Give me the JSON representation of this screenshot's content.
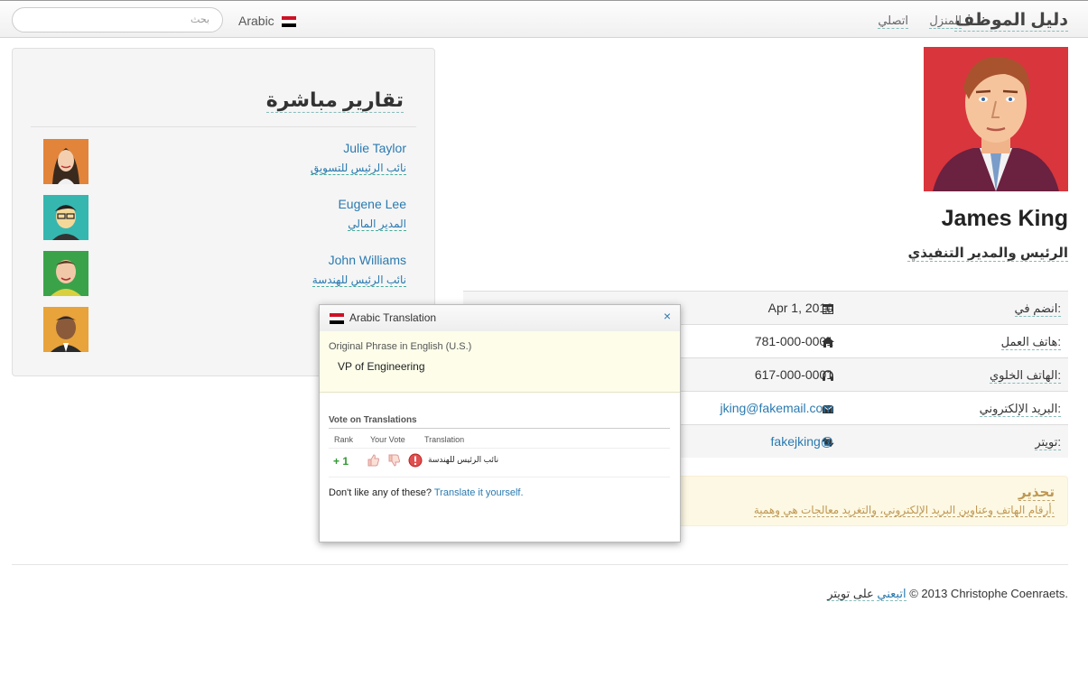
{
  "navbar": {
    "brand": "دليل الموظف",
    "home": "المنزل",
    "contact": "اتصلي",
    "language": "Arabic",
    "search_placeholder": "بحث"
  },
  "reports": {
    "title": "تقارير مباشرة",
    "items": [
      {
        "name": "Julie Taylor",
        "title": "نائب الرئيس للتسويق"
      },
      {
        "name": "Eugene Lee",
        "title": "المدير المالي"
      },
      {
        "name": "John Williams",
        "title": "نائب الرئيس للهندسة"
      },
      {
        "name": "",
        "title": ""
      }
    ]
  },
  "profile": {
    "name": "James King",
    "title": "الرئيس والمدير التنفيذي",
    "details": [
      {
        "label": "انضم في:",
        "value": "Apr 1, 2010",
        "icon": "calendar-icon"
      },
      {
        "label": "هاتف العمل:",
        "value": "781-000-0001",
        "icon": "home-icon"
      },
      {
        "label": "الهاتف الخلوي:",
        "value": "617-000-0001",
        "icon": "headphones-icon"
      },
      {
        "label": "البريد الإلكتروني:",
        "value": "jking@fakemail.com",
        "icon": "envelope-icon"
      },
      {
        "label": "تويتر:",
        "value": "fakejking@",
        "icon": "retweet-icon"
      }
    ]
  },
  "warning": {
    "heading": "تحذير",
    "text": "أرقام الهاتف وعناوين البريد الإلكتروني، والتغريد معالجات هي وهمية."
  },
  "footer": {
    "copyright": "© 2013 Christophe Coenraets.",
    "follow": "اتبعني",
    "on_twitter": "على تويتر"
  },
  "popup": {
    "title": "Arabic Translation",
    "close": "×",
    "original_label": "Original Phrase in English (U.S.)",
    "original_text": "VP of Engineering",
    "vote_heading": "Vote on Translations",
    "col_rank": "Rank",
    "col_vote": "Your Vote",
    "col_translation": "Translation",
    "rank_value": "+ 1",
    "translation": "نائب الرئيس للهندسة",
    "dislike_text": "Don't like any of these?",
    "translate_link": "Translate it yourself."
  },
  "colors": {
    "link": "#2a7ab0",
    "warning": "#c09853",
    "vote_up": "#339933"
  }
}
